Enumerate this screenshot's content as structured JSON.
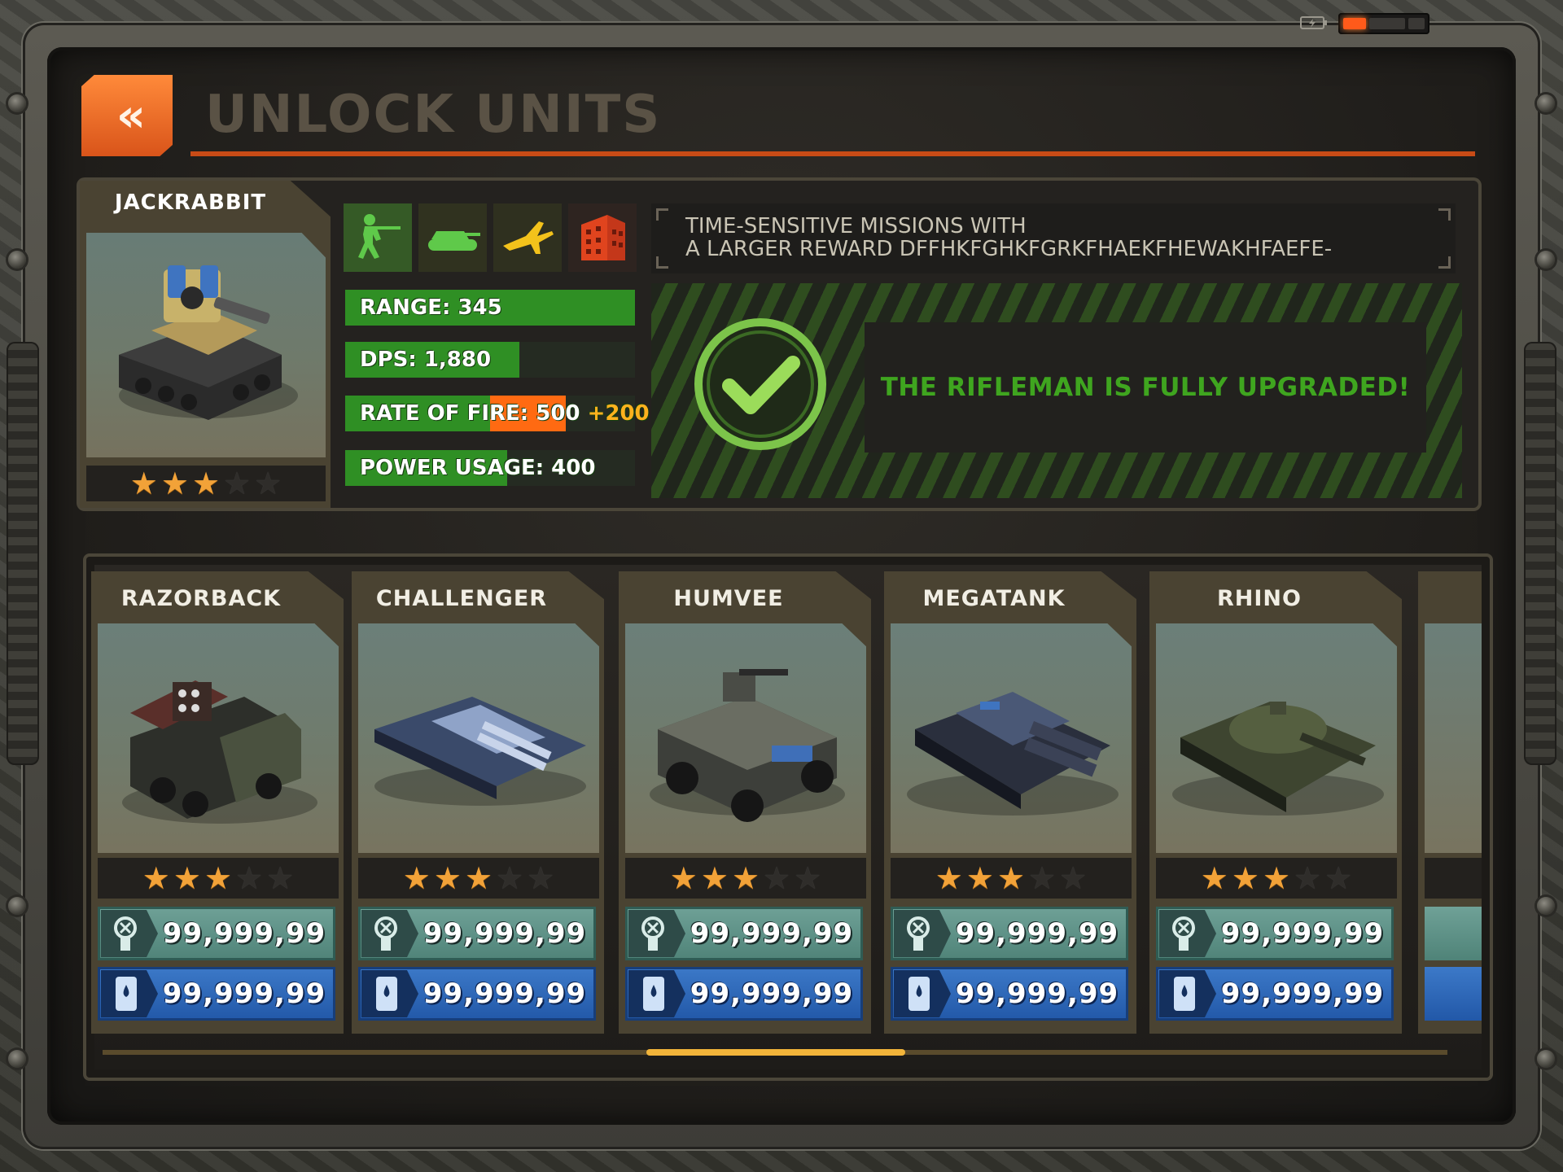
{
  "header": {
    "title": "UNLOCK UNITS",
    "back_icon": "double-chevron-left-icon"
  },
  "status": {
    "battery_icon": "plug-icon",
    "battery_level": 0.2
  },
  "featured": {
    "name": "JACKRABBIT",
    "stars": 3,
    "max_stars": 5,
    "categories": [
      "infantry-icon",
      "tank-icon",
      "jet-icon",
      "building-icon"
    ],
    "stats": [
      {
        "label": "RANGE: 345",
        "fill": 1.0
      },
      {
        "label": "DPS: 1,880",
        "fill": 0.6
      },
      {
        "label": "RATE OF FIRE: 500",
        "bonus": "+200",
        "fill": 0.5,
        "bonus_fill": 0.26
      },
      {
        "label": "POWER USAGE: 400",
        "fill": 0.56
      }
    ],
    "description_line1": "TIME-SENSITIVE MISSIONS WITH",
    "description_line2": "A LARGER REWARD DFFHKFGHKFGRKFHAEKFHEWAKHFAEFE-",
    "upgrade_message": "THE RIFLEMAN IS FULLY UPGRADED!"
  },
  "units": [
    {
      "name": "RAZORBACK",
      "stars": 3,
      "supply_cost": "99,999,99",
      "oil_cost": "99,999,99"
    },
    {
      "name": "CHALLENGER",
      "stars": 3,
      "supply_cost": "99,999,99",
      "oil_cost": "99,999,99"
    },
    {
      "name": "HUMVEE",
      "stars": 3,
      "supply_cost": "99,999,99",
      "oil_cost": "99,999,99"
    },
    {
      "name": "MEGATANK",
      "stars": 3,
      "supply_cost": "99,999,99",
      "oil_cost": "99,999,99"
    },
    {
      "name": "RHINO",
      "stars": 3,
      "supply_cost": "99,999,99",
      "oil_cost": "99,999,99"
    }
  ],
  "colors": {
    "accent": "#c84b16",
    "stat_green": "#2f8f24",
    "bonus_orange": "#ff6a12",
    "supply": "#5f9488",
    "oil": "#2d64b8",
    "star": "#f2a238"
  }
}
